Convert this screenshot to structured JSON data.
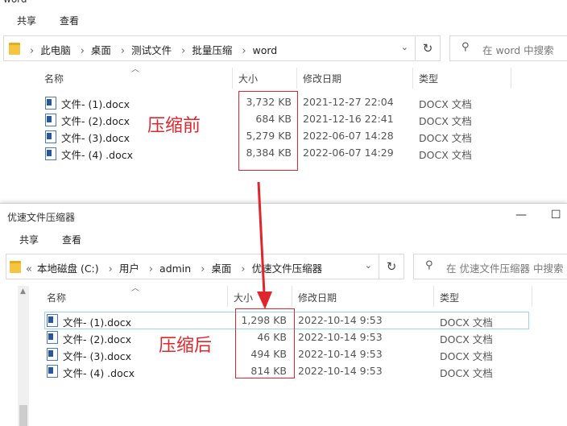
{
  "window1": {
    "title": "word",
    "ribbon": {
      "tab_share": "共享",
      "tab_view": "查看"
    },
    "breadcrumbs": [
      "此电脑",
      "桌面",
      "测试文件",
      "批量压缩",
      "word"
    ],
    "search_placeholder": "在 word 中搜索",
    "columns": {
      "name": "名称",
      "size": "大小",
      "modified": "修改日期",
      "type": "类型"
    },
    "files": [
      {
        "name": "文件- (1).docx",
        "size": "3,732 KB",
        "modified": "2021-12-27 22:04",
        "type": "DOCX 文档"
      },
      {
        "name": "文件- (2).docx",
        "size": "684 KB",
        "modified": "2021-12-16 22:41",
        "type": "DOCX 文档"
      },
      {
        "name": "文件- (3).docx",
        "size": "5,279 KB",
        "modified": "2022-06-07 14:28",
        "type": "DOCX 文档"
      },
      {
        "name": "文件- (4) .docx",
        "size": "8,384 KB",
        "modified": "2022-06-07 14:29",
        "type": "DOCX 文档"
      }
    ],
    "annotation": "压缩前"
  },
  "window2": {
    "title": "优速文件压缩器",
    "ribbon": {
      "tab_share": "共享",
      "tab_view": "查看"
    },
    "breadcrumb_overflow": "«",
    "breadcrumbs": [
      "本地磁盘 (C:)",
      "用户",
      "admin",
      "桌面",
      "优速文件压缩器"
    ],
    "search_placeholder": "在 优速文件压缩器 中搜索",
    "columns": {
      "name": "名称",
      "size": "大小",
      "modified": "修改日期",
      "type": "类型"
    },
    "files": [
      {
        "name": "文件- (1).docx",
        "size": "1,298 KB",
        "modified": "2022-10-14 9:53",
        "type": "DOCX 文档"
      },
      {
        "name": "文件- (2).docx",
        "size": "46 KB",
        "modified": "2022-10-14 9:53",
        "type": "DOCX 文档"
      },
      {
        "name": "文件- (3).docx",
        "size": "494 KB",
        "modified": "2022-10-14 9:53",
        "type": "DOCX 文档"
      },
      {
        "name": "文件- (4) .docx",
        "size": "814 KB",
        "modified": "2022-10-14 9:53",
        "type": "DOCX 文档"
      }
    ],
    "annotation": "压缩后",
    "controls": {
      "minimize": "—",
      "maximize": "☐"
    }
  },
  "colors": {
    "annotation_red": "#e0262d",
    "selection_border": "#99d1ff",
    "folder_yellow": "#f5c542"
  },
  "icons": {
    "folder": "folder-icon",
    "refresh": "refresh-icon",
    "dropdown": "chevron-down-icon",
    "search": "search-icon",
    "docx": "word-document-icon",
    "sort": "sort-up-icon"
  }
}
